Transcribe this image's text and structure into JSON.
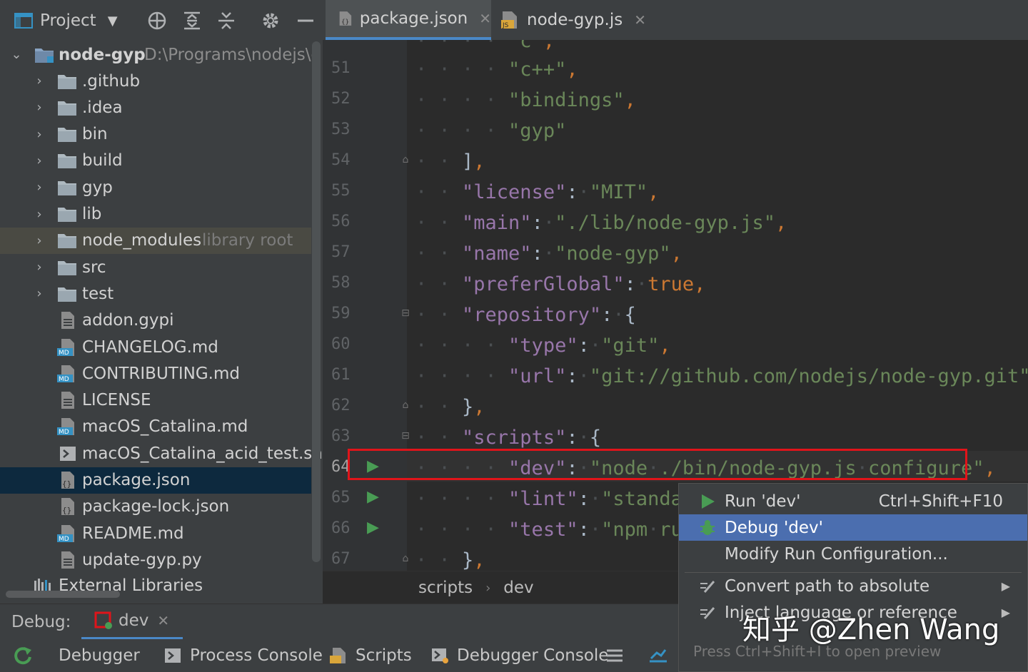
{
  "project_panel": {
    "title": "Project",
    "root": {
      "name": "node-gyp",
      "path": "D:\\Programs\\nodejs\\glo"
    },
    "folders": [
      ".github",
      ".idea",
      "bin",
      "build",
      "gyp",
      "lib",
      "node_modules",
      "src",
      "test"
    ],
    "library_root_label": "library root",
    "files": [
      "addon.gypi",
      "CHANGELOG.md",
      "CONTRIBUTING.md",
      "LICENSE",
      "macOS_Catalina.md",
      "macOS_Catalina_acid_test.sh",
      "package.json",
      "package-lock.json",
      "README.md",
      "update-gyp.py"
    ],
    "external_libraries": "External Libraries"
  },
  "editor_tabs": [
    {
      "label": "package.json",
      "active": true
    },
    {
      "label": "node-gyp.js",
      "active": false
    }
  ],
  "editor": {
    "line_numbers": [
      "51",
      "52",
      "53",
      "54",
      "55",
      "56",
      "57",
      "58",
      "59",
      "60",
      "61",
      "62",
      "63",
      "64",
      "65",
      "66",
      "67"
    ],
    "current_line": "64"
  },
  "breadcrumb": {
    "first": "scripts",
    "second": "dev"
  },
  "debug": {
    "label": "Debug:",
    "session": "dev",
    "tabs": [
      "Debugger",
      "Process Console",
      "Scripts",
      "Debugger Console"
    ]
  },
  "popup": {
    "items": [
      {
        "label": "Run 'dev'",
        "shortcut": "Ctrl+Shift+F10"
      },
      {
        "label": "Debug 'dev'",
        "shortcut": ""
      },
      {
        "label": "Modify Run Configuration...",
        "shortcut": ""
      },
      {
        "label": "Convert path to absolute",
        "shortcut": ""
      },
      {
        "label": "Inject language or reference",
        "shortcut": ""
      }
    ],
    "hint": "Press Ctrl+Shift+I to open preview"
  },
  "watermark": "知乎 @Zhen Wang",
  "colors": {
    "accent": "#4b6eaf",
    "highlight_box": "#e0141a",
    "run_green": "#499c54",
    "json_key": "#9876aa",
    "json_string": "#6a8759"
  }
}
